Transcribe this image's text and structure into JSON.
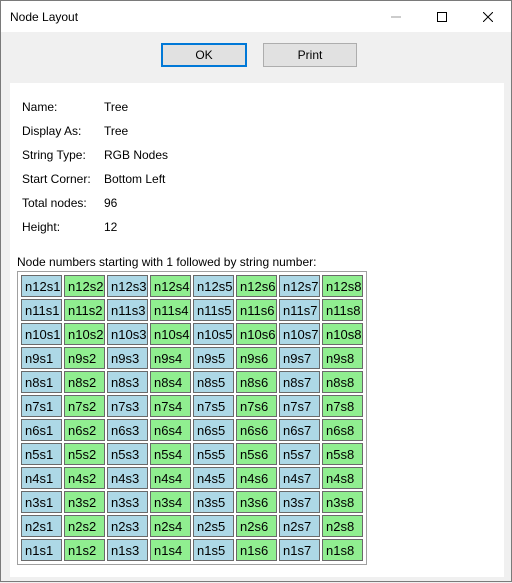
{
  "window": {
    "title": "Node Layout"
  },
  "buttons": {
    "ok": "OK",
    "print": "Print"
  },
  "info": [
    {
      "label": "Name:",
      "value": "Tree"
    },
    {
      "label": "Display As:",
      "value": "Tree"
    },
    {
      "label": "String Type:",
      "value": "RGB Nodes"
    },
    {
      "label": "Start Corner:",
      "value": "Bottom Left"
    },
    {
      "label": "Total nodes:",
      "value": "96"
    },
    {
      "label": "Height:",
      "value": "12"
    }
  ],
  "caption": "Node numbers starting with 1 followed by string number:",
  "colors": {
    "odd_column": "#add8e6",
    "even_column": "#90ee90"
  },
  "grid": [
    [
      "n12s1",
      "n12s2",
      "n12s3",
      "n12s4",
      "n12s5",
      "n12s6",
      "n12s7",
      "n12s8"
    ],
    [
      "n11s1",
      "n11s2",
      "n11s3",
      "n11s4",
      "n11s5",
      "n11s6",
      "n11s7",
      "n11s8"
    ],
    [
      "n10s1",
      "n10s2",
      "n10s3",
      "n10s4",
      "n10s5",
      "n10s6",
      "n10s7",
      "n10s8"
    ],
    [
      "n9s1",
      "n9s2",
      "n9s3",
      "n9s4",
      "n9s5",
      "n9s6",
      "n9s7",
      "n9s8"
    ],
    [
      "n8s1",
      "n8s2",
      "n8s3",
      "n8s4",
      "n8s5",
      "n8s6",
      "n8s7",
      "n8s8"
    ],
    [
      "n7s1",
      "n7s2",
      "n7s3",
      "n7s4",
      "n7s5",
      "n7s6",
      "n7s7",
      "n7s8"
    ],
    [
      "n6s1",
      "n6s2",
      "n6s3",
      "n6s4",
      "n6s5",
      "n6s6",
      "n6s7",
      "n6s8"
    ],
    [
      "n5s1",
      "n5s2",
      "n5s3",
      "n5s4",
      "n5s5",
      "n5s6",
      "n5s7",
      "n5s8"
    ],
    [
      "n4s1",
      "n4s2",
      "n4s3",
      "n4s4",
      "n4s5",
      "n4s6",
      "n4s7",
      "n4s8"
    ],
    [
      "n3s1",
      "n3s2",
      "n3s3",
      "n3s4",
      "n3s5",
      "n3s6",
      "n3s7",
      "n3s8"
    ],
    [
      "n2s1",
      "n2s2",
      "n2s3",
      "n2s4",
      "n2s5",
      "n2s6",
      "n2s7",
      "n2s8"
    ],
    [
      "n1s1",
      "n1s2",
      "n1s3",
      "n1s4",
      "n1s5",
      "n1s6",
      "n1s7",
      "n1s8"
    ]
  ]
}
